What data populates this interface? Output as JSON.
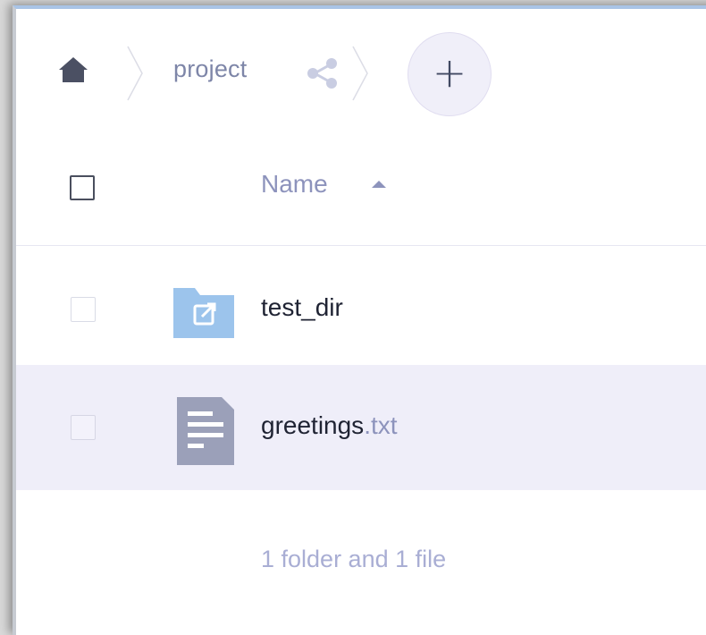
{
  "breadcrumb": {
    "home_icon": "home-icon",
    "folder": "project",
    "share_icon": "share-icon",
    "add_label": "+"
  },
  "table": {
    "select_all_icon": "checkbox",
    "columns": [
      {
        "label": "Name",
        "sort": "ascending"
      }
    ],
    "rows": [
      {
        "icon": "shared-folder-icon",
        "name": "test_dir",
        "ext": ""
      },
      {
        "icon": "text-file-icon",
        "name": "greetings",
        "ext": ".txt",
        "selected": true
      }
    ]
  },
  "footer": {
    "summary": "1 folder and 1 file"
  },
  "colors": {
    "accent": "#8d93bc",
    "selected_row": "#efeef9",
    "folder": "#9cc4ec",
    "file": "#9ba0b9",
    "window_border": "#a9c4e6"
  }
}
